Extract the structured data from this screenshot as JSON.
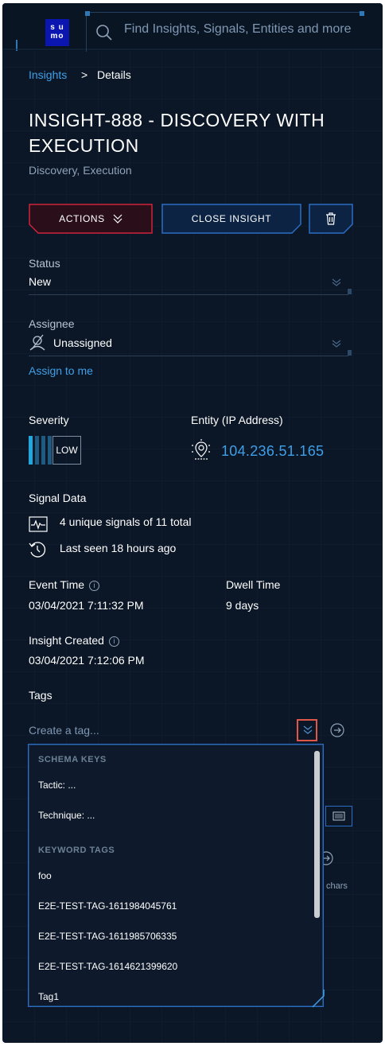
{
  "app": {
    "logo_line1": "s u",
    "logo_line2": "mo"
  },
  "search": {
    "placeholder": "Find Insights, Signals, Entities and more"
  },
  "breadcrumb": {
    "parent": "Insights",
    "separator": ">",
    "current": "Details"
  },
  "insight": {
    "title": "INSIGHT-888 - DISCOVERY WITH EXECUTION",
    "subtitle": "Discovery, Execution"
  },
  "actions": {
    "actions_label": "ACTIONS",
    "close_label": "CLOSE INSIGHT"
  },
  "status": {
    "label": "Status",
    "value": "New"
  },
  "assignee": {
    "label": "Assignee",
    "value": "Unassigned",
    "assign_link": "Assign to me"
  },
  "severity": {
    "label": "Severity",
    "value": "LOW",
    "level": 1,
    "max_level": 4
  },
  "entity": {
    "label": "Entity (IP Address)",
    "value": "104.236.51.165"
  },
  "signal_data": {
    "label": "Signal Data",
    "signals_text": "4 unique signals of 11 total",
    "last_seen_text": "Last seen 18 hours ago"
  },
  "event_time": {
    "label": "Event Time",
    "value": "03/04/2021 7:11:32 PM"
  },
  "dwell_time": {
    "label": "Dwell Time",
    "value": "9 days"
  },
  "insight_created": {
    "label": "Insight Created",
    "value": "03/04/2021 7:12:06 PM"
  },
  "tags": {
    "label": "Tags",
    "placeholder": "Create a tag...",
    "chars_suffix": "chars",
    "dropdown": {
      "schema_header": "SCHEMA KEYS",
      "schema_items": [
        "Tactic: ...",
        "Technique: ..."
      ],
      "keyword_header": "KEYWORD TAGS",
      "keyword_items": [
        "foo",
        "E2E-TEST-TAG-1611984045761",
        "E2E-TEST-TAG-1611985706335",
        "E2E-TEST-TAG-1614621399620",
        "Tag1"
      ]
    }
  },
  "colors": {
    "background": "#0b1626",
    "accent_blue": "#3fa0e8",
    "actions_red": "#d0233a",
    "close_blue": "#2a6ec4",
    "severity_on": "#1fa8e0",
    "severity_off": "#1f5a80",
    "highlight_box": "#e0574a"
  },
  "icons": {
    "search": "search-icon",
    "chevron": "double-chevron-down-icon",
    "trash": "trash-icon",
    "unassigned": "no-user-icon",
    "entity": "ip-address-icon",
    "signal": "pulse-icon",
    "clock": "history-clock-icon",
    "info": "info-icon",
    "submit": "circle-arrow-right-icon"
  }
}
